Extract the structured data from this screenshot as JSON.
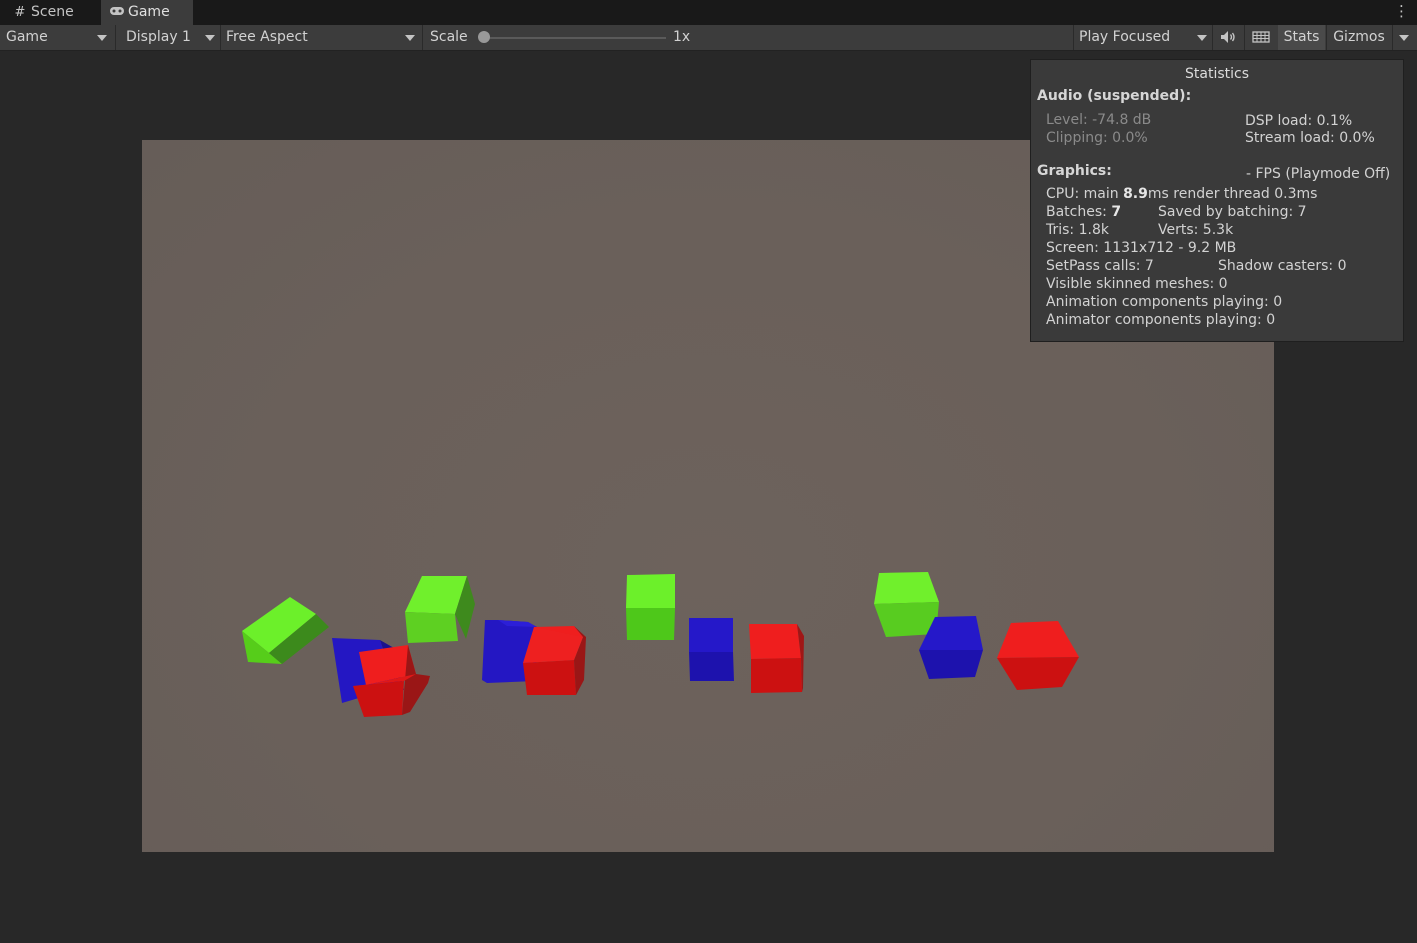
{
  "tabs": [
    {
      "label": "Scene",
      "icon": "grid-icon"
    },
    {
      "label": "Game",
      "icon": "gamepad-icon"
    }
  ],
  "toolbar": {
    "mode": "Game",
    "display": "Display 1",
    "aspect": "Free Aspect",
    "scale_label": "Scale",
    "scale_value": "1x",
    "scale_fraction": 0.0,
    "play_mode": "Play Focused",
    "stats_label": "Stats",
    "gizmos_label": "Gizmos"
  },
  "stats": {
    "title": "Statistics",
    "audio_header": "Audio (suspended):",
    "level": "Level: -74.8 dB",
    "clipping": "Clipping: 0.0%",
    "dsp_load": "DSP load: 0.1%",
    "stream_load": "Stream load: 0.0%",
    "graphics_header": "Graphics:",
    "fps": "- FPS (Playmode Off)",
    "cpu_prefix": "CPU: main ",
    "cpu_main": "8.9",
    "cpu_suffix": "ms  render thread 0.3ms",
    "batches_prefix": "Batches: ",
    "batches_value": "7",
    "saved_by_batching": "Saved by batching: 7",
    "tris": "Tris: 1.8k",
    "verts": "Verts: 5.3k",
    "screen": "Screen: 1131x712 - 9.2 MB",
    "setpass": "SetPass calls: 7",
    "shadow_casters": "Shadow casters: 0",
    "skinned": "Visible skinned meshes: 0",
    "animation": "Animation components playing: 0",
    "animator": "Animator components playing: 0"
  },
  "colors": {
    "cube_green": "#66ee22",
    "cube_blue": "#2219c8",
    "cube_red": "#ee1c1c",
    "viewport_bg": "#6a605a"
  }
}
